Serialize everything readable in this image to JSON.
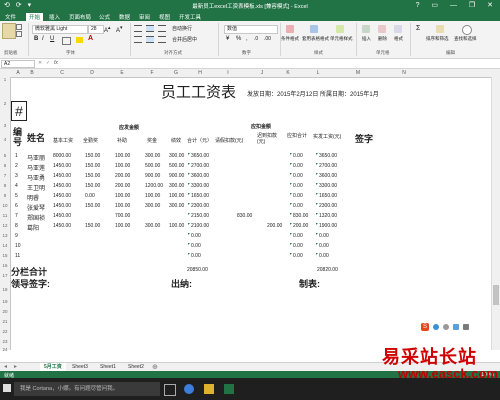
{
  "window": {
    "title": "最新员工excel工资表模板.xls [兼容模式] - Excel",
    "quick_access": "⟲ ⟳ ▾",
    "controls": "? ▭ — ❐ ✕"
  },
  "menu": {
    "tabs": [
      "开始",
      "插入",
      "页面布局",
      "公式",
      "数据",
      "审阅",
      "视图",
      "开发工具"
    ],
    "file": "文件"
  },
  "ribbon": {
    "font_name": "微软雅黑 Light",
    "font_size": "28",
    "number_format": "数值",
    "groups": [
      "剪贴板",
      "字体",
      "对齐方式",
      "数字",
      "样式",
      "单元格",
      "编辑"
    ],
    "buttons": {
      "wrap": "自动换行",
      "merge": "合并后居中",
      "cond_format": "条件格式",
      "table_format": "套用表格格式",
      "cell_style": "单元格样式",
      "insert": "插入",
      "delete": "删除",
      "format": "格式",
      "sort": "排序和筛选",
      "find": "查找和选择"
    }
  },
  "formula_bar": {
    "name_box": "A2",
    "fx": "fx",
    "value": ""
  },
  "columns": [
    "A",
    "B",
    "C",
    "D",
    "E",
    "F",
    "G",
    "H",
    "I",
    "J",
    "K",
    "L",
    "M",
    "N"
  ],
  "rows": [
    "1",
    "2",
    "3",
    "4",
    "5",
    "6",
    "7",
    "8",
    "9",
    "10",
    "11",
    "12",
    "13",
    "14",
    "15",
    "16",
    "17",
    "18",
    "19",
    "20",
    "21",
    "22",
    "23",
    "24",
    "25",
    "26",
    "27",
    "28"
  ],
  "sheet": {
    "hash": "#",
    "title": "员工工资表",
    "issue_date": "发放日期：2015年2月12日  所属日期：2015年1月",
    "header_no": "编号",
    "header_name": "姓名",
    "group_payable": "应发金额",
    "group_deduct": "应扣金额",
    "sub": [
      "基本工资",
      "全勤奖",
      "补助",
      "奖金",
      "绩效",
      "合计（元）",
      "请假扣款(元)",
      "迟到扣款(元)",
      "应扣合计",
      "实发工资(元)"
    ],
    "sign": "签字",
    "data": [
      {
        "no": "1",
        "name": "马亚丽",
        "c1": "8000.00",
        "c2": "150.00",
        "c3": "100.00",
        "c4": "300.00",
        "c5": "300.00",
        "total": "3650.00",
        "leave": "",
        "late": "",
        "dsum": "0.00",
        "net": "3650.00"
      },
      {
        "no": "2",
        "name": "马亚莲",
        "c1": "1450.00",
        "c2": "150.00",
        "c3": "100.00",
        "c4": "500.00",
        "c5": "500.00",
        "total": "2700.00",
        "leave": "",
        "late": "",
        "dsum": "0.00",
        "net": "2700.00"
      },
      {
        "no": "3",
        "name": "马亚勇",
        "c1": "1450.00",
        "c2": "150.00",
        "c3": "200.00",
        "c4": "900.00",
        "c5": "900.00",
        "total": "3600.00",
        "leave": "",
        "late": "",
        "dsum": "0.00",
        "net": "3600.00"
      },
      {
        "no": "4",
        "name": "王卫明",
        "c1": "1450.00",
        "c2": "150.00",
        "c3": "200.00",
        "c4": "1200.00",
        "c5": "300.00",
        "total": "3300.00",
        "leave": "",
        "late": "",
        "dsum": "0.00",
        "net": "3300.00"
      },
      {
        "no": "5",
        "name": "明睿",
        "c1": "1450.00",
        "c2": "0.00",
        "c3": "100.00",
        "c4": "100.00",
        "c5": "100.00",
        "total": "1650.00",
        "leave": "",
        "late": "",
        "dsum": "0.00",
        "net": "1650.00"
      },
      {
        "no": "6",
        "name": "张爱琴",
        "c1": "1450.00",
        "c2": "150.00",
        "c3": "100.00",
        "c4": "300.00",
        "c5": "300.00",
        "total": "2300.00",
        "leave": "",
        "late": "",
        "dsum": "0.00",
        "net": "2300.00"
      },
      {
        "no": "7",
        "name": "郑国祯",
        "c1": "1450.00",
        "c2": "",
        "c3": "700.00",
        "c4": "",
        "c5": "",
        "total": "2150.00",
        "leave": "830.00",
        "late": "",
        "dsum": "830.00",
        "net": "1320.00"
      },
      {
        "no": "8",
        "name": "葛阳",
        "c1": "1450.00",
        "c2": "150.00",
        "c3": "100.00",
        "c4": "300.00",
        "c5": "100.00",
        "total": "2100.00",
        "leave": "",
        "late": "200.00",
        "dsum": "200.00",
        "net": "1900.00"
      },
      {
        "no": "9",
        "name": "",
        "c1": "",
        "c2": "",
        "c3": "",
        "c4": "",
        "c5": "",
        "total": "0.00",
        "leave": "",
        "late": "",
        "dsum": "0.00",
        "net": "0.00"
      },
      {
        "no": "10",
        "name": "",
        "c1": "",
        "c2": "",
        "c3": "",
        "c4": "",
        "c5": "",
        "total": "0.00",
        "leave": "",
        "late": "",
        "dsum": "0.00",
        "net": "0.00"
      },
      {
        "no": "11",
        "name": "",
        "c1": "",
        "c2": "",
        "c3": "",
        "c4": "",
        "c5": "",
        "total": "0.00",
        "leave": "",
        "late": "",
        "dsum": "0.00",
        "net": "0.00"
      }
    ],
    "subtotal_label": "分栏合计",
    "subtotal_total": "20850.00",
    "subtotal_net": "20820.00",
    "leader_sign": "领导签字:",
    "cashier": "出纳:",
    "maker": "制表:"
  },
  "sheet_tabs": [
    "5月工资",
    "Sheet3",
    "Sheet1",
    "Sheet2"
  ],
  "status": {
    "left": "就绪",
    "zoom": "100%"
  },
  "taskbar": {
    "cortana": "我是 Cortana，小娜。有问题尽管问我。"
  },
  "watermark": {
    "line1": "易采站长站",
    "line2": "www.easck.com"
  },
  "colors": {
    "excel_green": "#217346",
    "watermark_red": "#d10000"
  }
}
